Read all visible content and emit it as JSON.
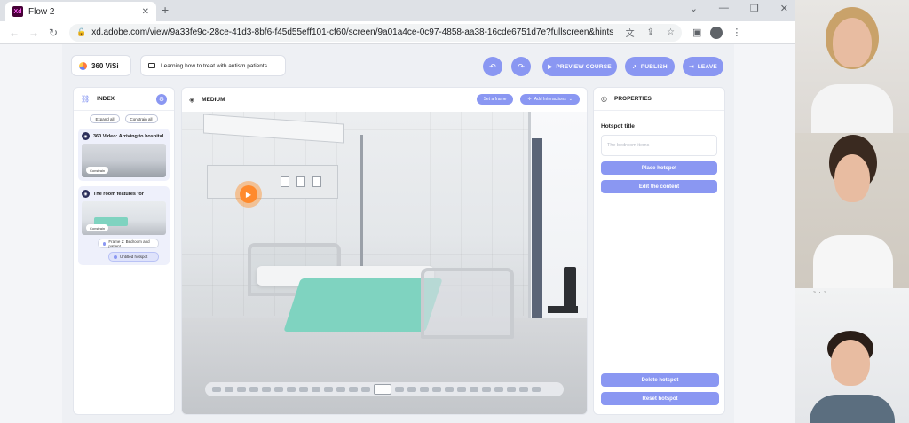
{
  "browser": {
    "tab_title": "Flow 2",
    "tab_close": "✕",
    "new_tab": "+",
    "url": "xd.adobe.com/view/9a33fe9c-28ce-41d3-8bf6-f45d55eff101-cf60/screen/9a01a4ce-0c97-4858-aa38-16cde6751d7e?fullscreen&hints=off",
    "app_logo": "Xd",
    "win_controls": [
      "⌄",
      "—",
      "❐",
      "✕"
    ]
  },
  "header": {
    "brand": "360 ViSi",
    "course_title": "Learning how to treat with autism patients",
    "preview_label": "PREVIEW COURSE",
    "publish_label": "PUBLISH",
    "leave_label": "LEAVE"
  },
  "index_panel": {
    "title": "INDEX",
    "expand_all": "Expand all",
    "constrain_all": "Constrain all",
    "scenes": [
      {
        "title": "360 Video: Arriving to hospital",
        "badge": "Constrain"
      },
      {
        "title": "The room features for",
        "badge": "Constrain"
      }
    ],
    "sub_items": [
      "Frame 2: Bedroom and patient",
      "Untitled hotspot"
    ]
  },
  "medium_panel": {
    "title": "MEDIUM",
    "set_frame": "Set a frame",
    "add_interactions": "Add Interactions"
  },
  "properties_panel": {
    "title": "PROPERTIES",
    "hotspot_title_label": "Hotspot title",
    "hotspot_title_placeholder": "The bedroom items",
    "place_hotspot": "Place hotspot",
    "edit_content": "Edit the content",
    "delete_hotspot": "Delete hotspot",
    "reset_hotspot": "Reset hotspot"
  },
  "colors": {
    "accent": "#8a97f2",
    "hotspot": "#ff8a2c",
    "sheet": "#7fd3c0"
  },
  "icons": [
    "back-arrow-icon",
    "forward-arrow-icon",
    "reload-icon",
    "lock-icon",
    "translate-icon",
    "share-icon",
    "star-icon",
    "sidebar-icon",
    "profile-icon",
    "menu-icon",
    "undo-icon",
    "redo-icon",
    "play-icon",
    "rocket-icon",
    "exit-icon",
    "tree-icon",
    "gear-icon",
    "layers-icon",
    "target-icon"
  ]
}
